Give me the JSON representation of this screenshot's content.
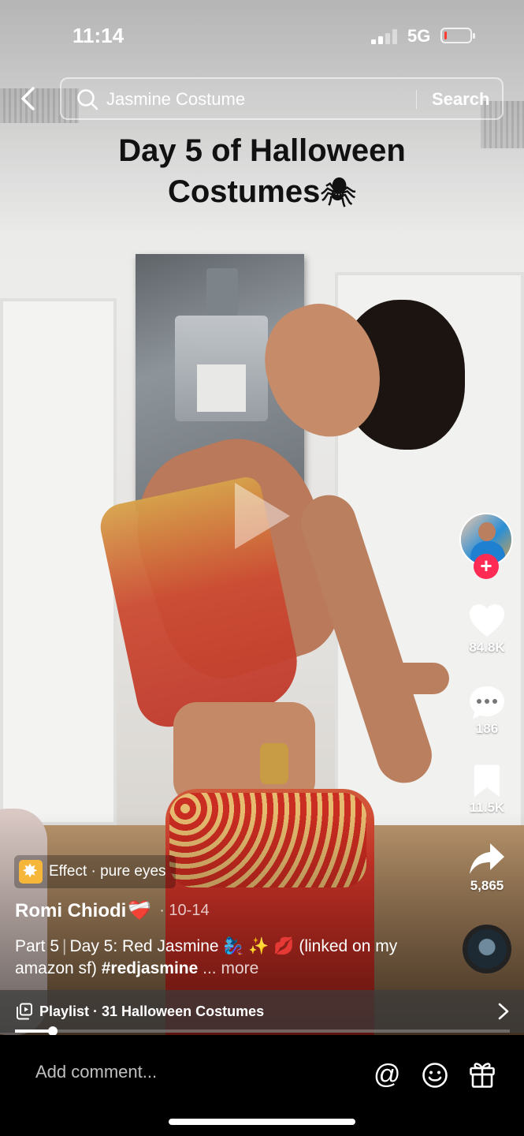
{
  "status_bar": {
    "time": "11:14",
    "network": "5G",
    "battery_level": 0.1
  },
  "search": {
    "query": "Jasmine Costume",
    "button_label": "Search",
    "back_icon": "chevron-left-icon",
    "search_icon": "magnifier-icon"
  },
  "video": {
    "caption_line1": "Day 5 of Halloween",
    "caption_line2": "Costumes"
  },
  "right_rail": {
    "likes": "84.8K",
    "comments": "186",
    "saves": "11.5K",
    "shares": "5,865"
  },
  "effect": {
    "label": "Effect · pure eyes"
  },
  "post": {
    "author": "Romi Chiodi",
    "author_emoji": "❤️‍🩹",
    "date": "· 10-14",
    "part": "Part 5",
    "desc_main": "Day 5: Red Jasmine 🧞‍♀️ ✨ 💋 (linked on my amazon sf)",
    "hashtag": "#redjasmine",
    "more": "... more"
  },
  "playlist": {
    "label": "Playlist · 31 Halloween Costumes"
  },
  "playback": {
    "progress": 0.076
  },
  "comment_bar": {
    "placeholder": "Add comment..."
  },
  "colors": {
    "follow_red": "#fe2c55",
    "battery_red": "#ff3b30",
    "effect_yellow": "#f6b63a"
  }
}
